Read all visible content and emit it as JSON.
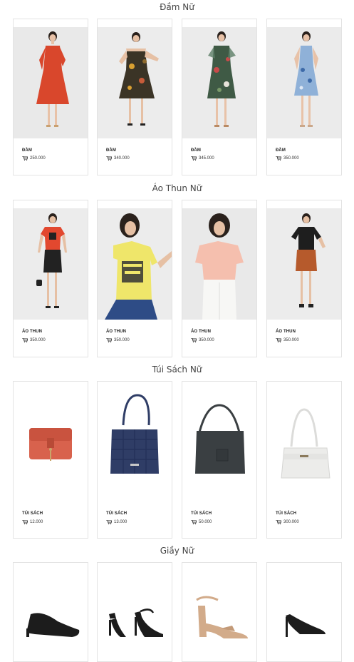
{
  "sections": [
    {
      "title": "Đầm Nữ",
      "products": [
        {
          "category": "ĐẦM",
          "price": "250.000",
          "image": "red-floral-dress-model",
          "colors": {
            "dress": "#d9472c"
          }
        },
        {
          "category": "ĐẦM",
          "price": "340.000",
          "image": "dark-floral-offshoulder-dress-model",
          "colors": {
            "dress": "#3b3426"
          }
        },
        {
          "category": "ĐẦM",
          "price": "345.000",
          "image": "dark-green-floral-dress-model",
          "colors": {
            "dress": "#3f5a45"
          }
        },
        {
          "category": "ĐẦM",
          "price": "350.000",
          "image": "blue-floral-dress-model",
          "colors": {
            "dress": "#8fb1d8"
          }
        }
      ]
    },
    {
      "title": "Áo Thun Nữ",
      "products": [
        {
          "category": "ÁO THUN",
          "price": "350.000",
          "image": "red-tshirt-black-skirt-model",
          "colors": {
            "top": "#e2482f",
            "bottom": "#222222"
          }
        },
        {
          "category": "ÁO THUN",
          "price": "350.000",
          "image": "yellow-graphic-tshirt-model",
          "colors": {
            "top": "#efe66a",
            "bottom": "#2e4c86"
          }
        },
        {
          "category": "ÁO THUN",
          "price": "350.000",
          "image": "peach-tshirt-white-pants-model",
          "colors": {
            "top": "#f5bfae",
            "bottom": "#f4f4f2"
          }
        },
        {
          "category": "ÁO THUN",
          "price": "350.000",
          "image": "black-polo-brown-shorts-model",
          "colors": {
            "top": "#1e1e1e",
            "bottom": "#b65a2c"
          }
        }
      ]
    },
    {
      "title": "Túi Sách Nữ",
      "products": [
        {
          "category": "TÚI SÁCH",
          "price": "12.000",
          "image": "coral-crossbody-bag",
          "colors": {
            "bag": "#d8624d"
          }
        },
        {
          "category": "TÚI SÁCH",
          "price": "13.000",
          "image": "navy-woven-hobo-bag",
          "colors": {
            "bag": "#2f3d66"
          }
        },
        {
          "category": "TÚI SÁCH",
          "price": "50.000",
          "image": "dark-grey-hobo-bag",
          "colors": {
            "bag": "#3a3f42"
          }
        },
        {
          "category": "TÚI SÁCH",
          "price": "300.000",
          "image": "white-shoulder-bag",
          "colors": {
            "bag": "#ececea"
          }
        }
      ]
    },
    {
      "title": "Giầy Nữ",
      "products": [
        {
          "category": "",
          "price": "",
          "image": "black-pointed-mule",
          "colors": {
            "shoe": "#1c1c1c"
          }
        },
        {
          "category": "",
          "price": "",
          "image": "black-strappy-heeled-sandal",
          "colors": {
            "shoe": "#1c1c1c"
          }
        },
        {
          "category": "",
          "price": "",
          "image": "beige-block-heel-sandal",
          "colors": {
            "shoe": "#d2ab8a"
          }
        },
        {
          "category": "",
          "price": "",
          "image": "black-pointed-pump",
          "colors": {
            "shoe": "#1c1c1c"
          }
        }
      ]
    }
  ]
}
